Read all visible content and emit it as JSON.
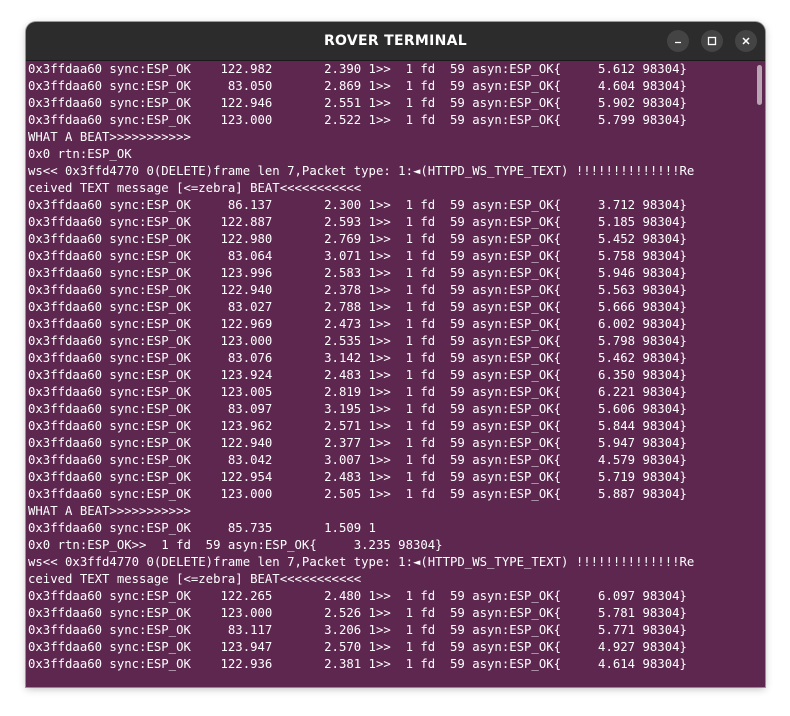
{
  "window": {
    "title": "ROVER TERMINAL",
    "background_color": "#5e2750",
    "text_color": "#ffffff",
    "titlebar_color": "#2c2c2c"
  },
  "controls": {
    "minimize_icon": "minimize-icon",
    "maximize_icon": "maximize-icon",
    "close_icon": "close-icon"
  },
  "terminal": {
    "lines": [
      "0x3ffdaa60 sync:ESP_OK    122.982       2.390 1>>  1 fd  59 asyn:ESP_OK{     5.612 98304}",
      "0x3ffdaa60 sync:ESP_OK     83.050       2.869 1>>  1 fd  59 asyn:ESP_OK{     4.604 98304}",
      "0x3ffdaa60 sync:ESP_OK    122.946       2.551 1>>  1 fd  59 asyn:ESP_OK{     5.902 98304}",
      "0x3ffdaa60 sync:ESP_OK    123.000       2.522 1>>  1 fd  59 asyn:ESP_OK{     5.799 98304}",
      "WHAT A BEAT>>>>>>>>>>>",
      "0x0 rtn:ESP_OK",
      "ws<< 0x3ffd4770 0(DELETE)frame len 7,Packet type: 1:◄(HTTPD_WS_TYPE_TEXT) !!!!!!!!!!!!!!Re",
      "ceived TEXT message [<=zebra] BEAT<<<<<<<<<<<",
      "0x3ffdaa60 sync:ESP_OK     86.137       2.300 1>>  1 fd  59 asyn:ESP_OK{     3.712 98304}",
      "0x3ffdaa60 sync:ESP_OK    122.887       2.593 1>>  1 fd  59 asyn:ESP_OK{     5.185 98304}",
      "0x3ffdaa60 sync:ESP_OK    122.980       2.769 1>>  1 fd  59 asyn:ESP_OK{     5.452 98304}",
      "0x3ffdaa60 sync:ESP_OK     83.064       3.071 1>>  1 fd  59 asyn:ESP_OK{     5.758 98304}",
      "0x3ffdaa60 sync:ESP_OK    123.996       2.583 1>>  1 fd  59 asyn:ESP_OK{     5.946 98304}",
      "0x3ffdaa60 sync:ESP_OK    122.940       2.378 1>>  1 fd  59 asyn:ESP_OK{     5.563 98304}",
      "0x3ffdaa60 sync:ESP_OK     83.027       2.788 1>>  1 fd  59 asyn:ESP_OK{     5.666 98304}",
      "0x3ffdaa60 sync:ESP_OK    122.969       2.473 1>>  1 fd  59 asyn:ESP_OK{     6.002 98304}",
      "0x3ffdaa60 sync:ESP_OK    123.000       2.535 1>>  1 fd  59 asyn:ESP_OK{     5.798 98304}",
      "0x3ffdaa60 sync:ESP_OK     83.076       3.142 1>>  1 fd  59 asyn:ESP_OK{     5.462 98304}",
      "0x3ffdaa60 sync:ESP_OK    123.924       2.483 1>>  1 fd  59 asyn:ESP_OK{     6.350 98304}",
      "0x3ffdaa60 sync:ESP_OK    123.005       2.819 1>>  1 fd  59 asyn:ESP_OK{     6.221 98304}",
      "0x3ffdaa60 sync:ESP_OK     83.097       3.195 1>>  1 fd  59 asyn:ESP_OK{     5.606 98304}",
      "0x3ffdaa60 sync:ESP_OK    123.962       2.571 1>>  1 fd  59 asyn:ESP_OK{     5.844 98304}",
      "0x3ffdaa60 sync:ESP_OK    122.940       2.377 1>>  1 fd  59 asyn:ESP_OK{     5.947 98304}",
      "0x3ffdaa60 sync:ESP_OK     83.042       3.007 1>>  1 fd  59 asyn:ESP_OK{     4.579 98304}",
      "0x3ffdaa60 sync:ESP_OK    122.954       2.483 1>>  1 fd  59 asyn:ESP_OK{     5.719 98304}",
      "0x3ffdaa60 sync:ESP_OK    123.000       2.505 1>>  1 fd  59 asyn:ESP_OK{     5.887 98304}",
      "WHAT A BEAT>>>>>>>>>>>",
      "0x3ffdaa60 sync:ESP_OK     85.735       1.509 1",
      "0x0 rtn:ESP_OK>>  1 fd  59 asyn:ESP_OK{     3.235 98304}",
      "ws<< 0x3ffd4770 0(DELETE)frame len 7,Packet type: 1:◄(HTTPD_WS_TYPE_TEXT) !!!!!!!!!!!!!!Re",
      "ceived TEXT message [<=zebra] BEAT<<<<<<<<<<<",
      "0x3ffdaa60 sync:ESP_OK    122.265       2.480 1>>  1 fd  59 asyn:ESP_OK{     6.097 98304}",
      "0x3ffdaa60 sync:ESP_OK    123.000       2.526 1>>  1 fd  59 asyn:ESP_OK{     5.781 98304}",
      "0x3ffdaa60 sync:ESP_OK     83.117       3.206 1>>  1 fd  59 asyn:ESP_OK{     5.771 98304}",
      "0x3ffdaa60 sync:ESP_OK    123.947       2.570 1>>  1 fd  59 asyn:ESP_OK{     4.927 98304}",
      "0x3ffdaa60 sync:ESP_OK    122.936       2.381 1>>  1 fd  59 asyn:ESP_OK{     4.614 98304}"
    ]
  }
}
